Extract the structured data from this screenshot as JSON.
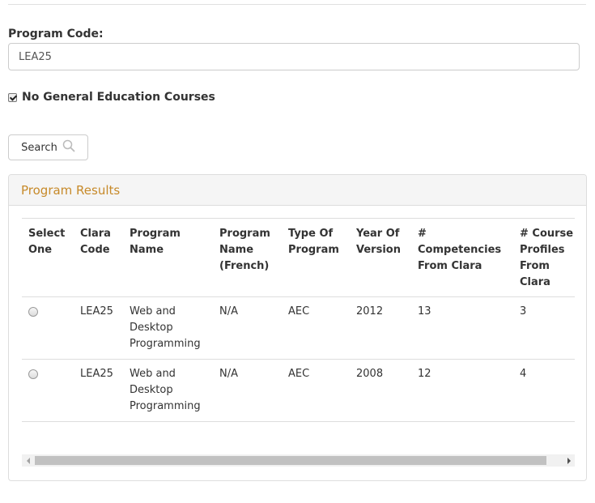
{
  "form": {
    "program_code_label": "Program Code:",
    "program_code_value": "LEA25",
    "no_gen_ed_label": "No General Education Courses",
    "no_gen_ed_checked": true,
    "search_label": "Search"
  },
  "results": {
    "title": "Program Results",
    "columns": [
      "Select One",
      "Clara Code",
      "Program Name",
      "Program Name (French)",
      "Type Of Program",
      "Year Of Version",
      "# Competencies From Clara",
      "# Course Profiles From Clara"
    ],
    "rows": [
      {
        "selected": false,
        "clara_code": "LEA25",
        "program_name": "Web and Desktop Programming",
        "program_name_french": "N/A",
        "type": "AEC",
        "year": "2012",
        "competencies": "13",
        "course_profiles": "3"
      },
      {
        "selected": false,
        "clara_code": "LEA25",
        "program_name": "Web and Desktop Programming",
        "program_name_french": "N/A",
        "type": "AEC",
        "year": "2008",
        "competencies": "12",
        "course_profiles": "4"
      }
    ]
  },
  "colors": {
    "panel_title": "#c78a2a",
    "border": "#dddddd"
  },
  "icons": {
    "search_button": "search-icon",
    "scroll_left": "chevron-left-icon",
    "scroll_right": "chevron-right-icon"
  }
}
